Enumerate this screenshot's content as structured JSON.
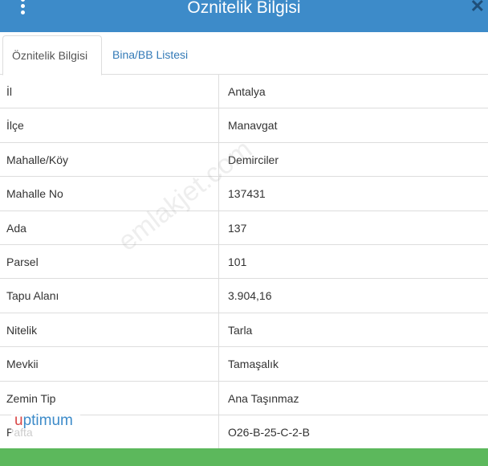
{
  "header": {
    "title": "Öznitelik Bilgisi",
    "menu_icon": "vertical-dots-icon",
    "close_icon": "close-icon",
    "close_glyph": "✕",
    "background": "#3d8bc9"
  },
  "tabs": [
    {
      "label": "Öznitelik Bilgisi",
      "active": true
    },
    {
      "label": "Bina/BB Listesi",
      "active": false
    }
  ],
  "rows": [
    {
      "label": "İl",
      "value": "Antalya"
    },
    {
      "label": "İlçe",
      "value": "Manavgat"
    },
    {
      "label": "Mahalle/Köy",
      "value": "Demirciler"
    },
    {
      "label": "Mahalle No",
      "value": "137431"
    },
    {
      "label": "Ada",
      "value": "137"
    },
    {
      "label": "Parsel",
      "value": "101"
    },
    {
      "label": "Tapu Alanı",
      "value": "3.904,16"
    },
    {
      "label": "Nitelik",
      "value": "Tarla"
    },
    {
      "label": "Mevkii",
      "value": "Tamaşalık"
    },
    {
      "label": "Zemin Tip",
      "value": "Ana Taşınmaz"
    },
    {
      "label": "Pafta",
      "value": "O26-B-25-C-2-B"
    }
  ],
  "watermark": "emlakjet.com",
  "logo": {
    "first": "u",
    "rest": "ptimum"
  },
  "footer": {
    "color": "#5cb85c"
  }
}
